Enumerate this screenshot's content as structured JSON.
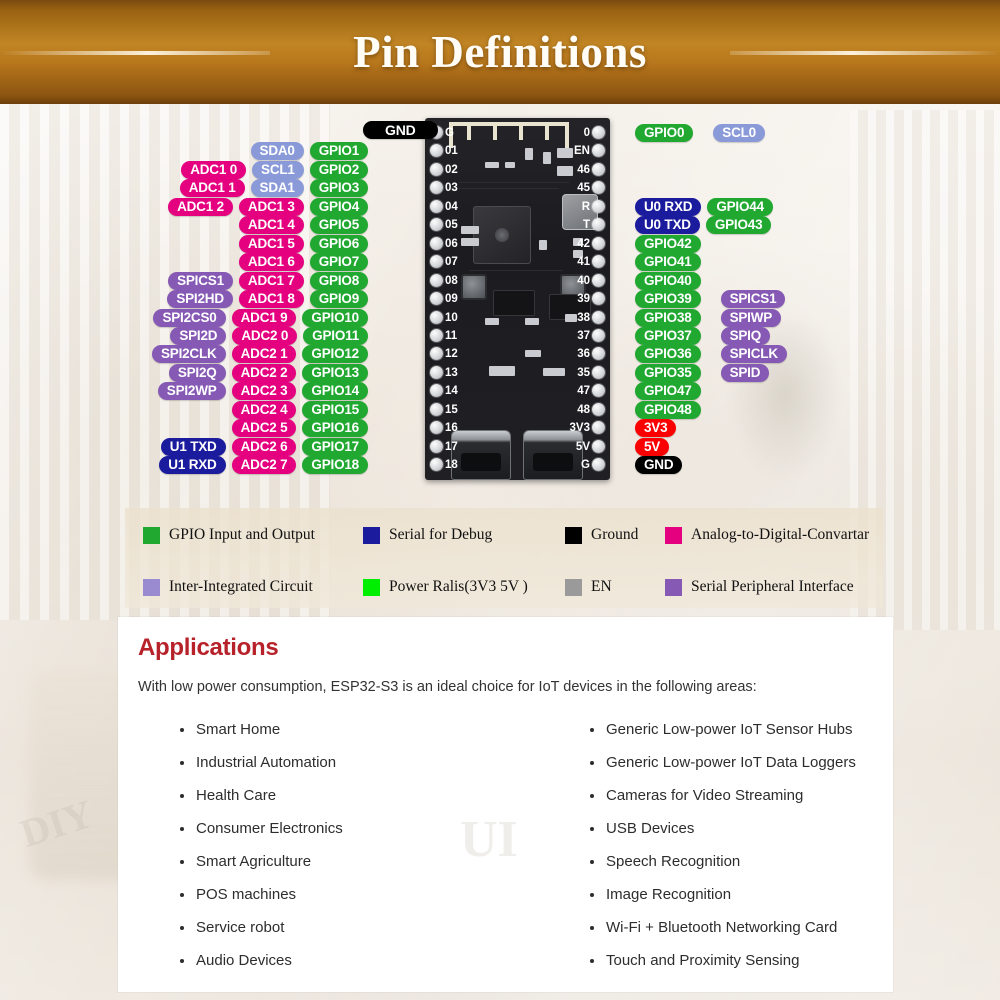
{
  "banner": {
    "title": "Pin Definitions"
  },
  "board": {
    "left_pin_numbers": [
      "G",
      "01",
      "02",
      "03",
      "04",
      "05",
      "06",
      "07",
      "08",
      "09",
      "10",
      "11",
      "12",
      "13",
      "14",
      "15",
      "16",
      "17",
      "18"
    ],
    "right_pin_numbers": [
      "0",
      "EN",
      "46",
      "45",
      "R",
      "T",
      "42",
      "41",
      "40",
      "39",
      "38",
      "37",
      "36",
      "35",
      "47",
      "48",
      "3V3",
      "5V",
      "G"
    ]
  },
  "pinout": {
    "top_label": "GND",
    "left_rows": [
      {
        "far": "",
        "mid": "",
        "near": "SDA0",
        "gpio": "GPIO1"
      },
      {
        "far": "ADC1_0",
        "mid": "",
        "near": "SCL1",
        "gpio": "GPIO2"
      },
      {
        "far": "ADC1_1",
        "mid": "",
        "near": "SDA1",
        "gpio": "GPIO3"
      },
      {
        "far": "ADC1_2",
        "mid": "",
        "near": "ADC1_3",
        "gpio": "GPIO4"
      },
      {
        "far": "",
        "mid": "",
        "near": "ADC1_4",
        "gpio": "GPIO5"
      },
      {
        "far": "",
        "mid": "",
        "near": "ADC1_5",
        "gpio": "GPIO6"
      },
      {
        "far": "",
        "mid": "",
        "near": "ADC1_6",
        "gpio": "GPIO7"
      },
      {
        "far": "SPICS1",
        "mid": "",
        "near": "ADC1_7",
        "gpio": "GPIO8"
      },
      {
        "far": "SPI2HD",
        "mid": "",
        "near": "ADC1_8",
        "gpio": "GPIO9"
      },
      {
        "far": "SPI2CS0",
        "mid": "",
        "near": "ADC1_9",
        "gpio": "GPIO10"
      },
      {
        "far": "SPI2D",
        "mid": "",
        "near": "ADC2_0",
        "gpio": "GPIO11"
      },
      {
        "far": "SPI2CLK",
        "mid": "",
        "near": "ADC2_1",
        "gpio": "GPIO12"
      },
      {
        "far": "SPI2Q",
        "mid": "",
        "near": "ADC2_2",
        "gpio": "GPIO13"
      },
      {
        "far": "SPI2WP",
        "mid": "",
        "near": "ADC2_3",
        "gpio": "GPIO14"
      },
      {
        "far": "",
        "mid": "",
        "near": "ADC2_4",
        "gpio": "GPIO15"
      },
      {
        "far": "",
        "mid": "",
        "near": "ADC2_5",
        "gpio": "GPIO16"
      },
      {
        "far": "U1_TXD",
        "mid": "",
        "near": "ADC2_6",
        "gpio": "GPIO17"
      },
      {
        "far": "U1_RXD",
        "mid": "",
        "near": "ADC2_7",
        "gpio": "GPIO18"
      }
    ],
    "right_rows": [
      {
        "gpio": "GPIO0",
        "alt": "SCL0",
        "gpio_kind": "gpio",
        "alt_kind": "i2c"
      },
      {
        "gpio": "",
        "alt": "",
        "gpio_kind": "gpio",
        "alt_kind": "i2c"
      },
      {
        "gpio": "",
        "alt": "",
        "gpio_kind": "gpio",
        "alt_kind": "i2c"
      },
      {
        "gpio": "",
        "alt": "",
        "gpio_kind": "gpio",
        "alt_kind": "i2c"
      },
      {
        "gpio": "GPIO44",
        "alt": "U0_RXD",
        "gpio_kind": "gpio",
        "alt_kind": "uart"
      },
      {
        "gpio": "GPIO43",
        "alt": "U0_TXD",
        "gpio_kind": "gpio",
        "alt_kind": "uart"
      },
      {
        "gpio": "GPIO42",
        "alt": "",
        "gpio_kind": "gpio",
        "alt_kind": "spi"
      },
      {
        "gpio": "GPIO41",
        "alt": "",
        "gpio_kind": "gpio",
        "alt_kind": "spi"
      },
      {
        "gpio": "GPIO40",
        "alt": "",
        "gpio_kind": "gpio",
        "alt_kind": "spi"
      },
      {
        "gpio": "GPIO39",
        "alt": "SPICS1",
        "gpio_kind": "gpio",
        "alt_kind": "spi"
      },
      {
        "gpio": "GPIO38",
        "alt": "SPIWP",
        "gpio_kind": "gpio",
        "alt_kind": "spi"
      },
      {
        "gpio": "GPIO37",
        "alt": "SPIQ",
        "gpio_kind": "gpio",
        "alt_kind": "spi"
      },
      {
        "gpio": "GPIO36",
        "alt": "SPICLK",
        "gpio_kind": "gpio",
        "alt_kind": "spi"
      },
      {
        "gpio": "GPIO35",
        "alt": "SPID",
        "gpio_kind": "gpio",
        "alt_kind": "spi"
      },
      {
        "gpio": "GPIO47",
        "alt": "",
        "gpio_kind": "gpio",
        "alt_kind": "spi"
      },
      {
        "gpio": "GPIO48",
        "alt": "",
        "gpio_kind": "gpio",
        "alt_kind": "spi"
      },
      {
        "gpio": "3V3",
        "alt": "",
        "gpio_kind": "pwr",
        "alt_kind": "spi"
      },
      {
        "gpio": "5V",
        "alt": "",
        "gpio_kind": "pwr",
        "alt_kind": "spi"
      },
      {
        "gpio": "GND",
        "alt": "",
        "gpio_kind": "gnd",
        "alt_kind": "spi"
      }
    ]
  },
  "legend": {
    "items": [
      {
        "label": "GPIO Input and Output",
        "color": "#20a830"
      },
      {
        "label": "Serial for Debug",
        "color": "#1b1b9e"
      },
      {
        "label": "Ground",
        "color": "#000000"
      },
      {
        "label": "Analog-to-Digital-Convartar",
        "color": "#e4007f"
      },
      {
        "label": "Inter-Integrated Circuit",
        "color": "#9a8ad0"
      },
      {
        "label": "Power Ralis(3V3 5V )",
        "color": "#00ee00"
      },
      {
        "label": "EN",
        "color": "#9a9a9a"
      },
      {
        "label": "Serial Peripheral Interface",
        "color": "#8659b5"
      }
    ]
  },
  "applications": {
    "heading": "Applications",
    "intro": "With low power consumption, ESP32-S3 is an ideal choice for IoT devices in the following areas:",
    "column1": [
      "Smart Home",
      "Industrial Automation",
      "Health Care",
      "Consumer Electronics",
      "Smart Agriculture",
      "POS machines",
      "Service robot",
      "Audio Devices"
    ],
    "column2": [
      "Generic Low-power IoT Sensor Hubs",
      "Generic Low-power IoT Data Loggers",
      "Cameras for Video Streaming",
      "USB Devices",
      "Speech Recognition",
      "Image Recognition",
      "Wi-Fi + Bluetooth Networking Card",
      "Touch and Proximity Sensing"
    ]
  }
}
